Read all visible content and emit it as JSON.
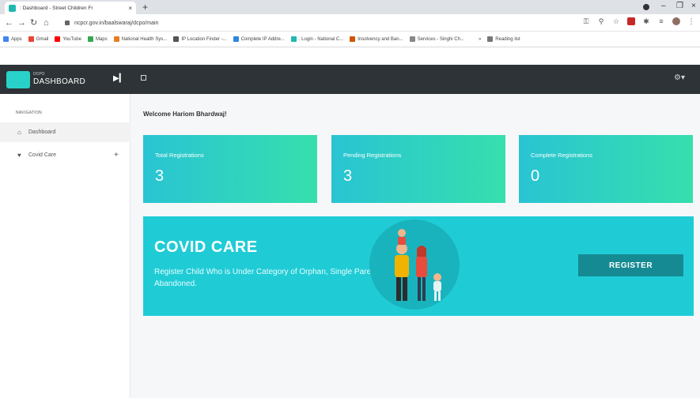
{
  "browser": {
    "tab_title": ": Dashboard - Street Children Fr",
    "tab_close": "×",
    "new_tab": "+",
    "url": "ncpcr.gov.in/baalswaraj/dcpo/main",
    "window_controls": [
      "–",
      "❐",
      "×"
    ],
    "bookmarks": [
      {
        "label": "Apps",
        "color": "#4285f4"
      },
      {
        "label": "Gmail",
        "color": "#ea4335"
      },
      {
        "label": "YouTube",
        "color": "#ff0000"
      },
      {
        "label": "Maps",
        "color": "#34a853"
      },
      {
        "label": "National Health Sys...",
        "color": "#e67e22"
      },
      {
        "label": "IP Location Finder -...",
        "color": "#555555"
      },
      {
        "label": "Complete IP Addre...",
        "color": "#2e86de"
      },
      {
        "label": ": Login - National C...",
        "color": "#1fb8b0"
      },
      {
        "label": "Insolvency and Ban...",
        "color": "#d35400"
      },
      {
        "label": "Services - Singhi Ch...",
        "color": "#888888"
      },
      {
        "label": "»",
        "color": "#ffffff"
      },
      {
        "label": "Reading list",
        "color": "#777777"
      }
    ]
  },
  "app": {
    "logo_small": "DCPO",
    "logo_text": "DASHBOARD",
    "nav_heading": "NAVIGATION",
    "nav_items": [
      {
        "label": "Dashboard",
        "icon": "home-icon"
      },
      {
        "label": "Covid Care",
        "icon": "heart-icon",
        "expand": "+"
      }
    ],
    "welcome": "Welcome Hariom Bhardwaj!",
    "stats": [
      {
        "label": "Total Registrations",
        "value": "3"
      },
      {
        "label": "Pending Registrations",
        "value": "3"
      },
      {
        "label": "Complete Registrations",
        "value": "0"
      }
    ],
    "covid_card": {
      "title": "COVID CARE",
      "description": "Register Child Who is Under Category of Orphan, Single Parent, Abandoned.",
      "button": "REGISTER"
    }
  },
  "colors": {
    "topbar": "#2d3336",
    "accent": "#29d2c9",
    "card": "#1fccd6",
    "button": "#158a92",
    "gradient_start": "#29c4d3",
    "gradient_end": "#36dfad"
  }
}
